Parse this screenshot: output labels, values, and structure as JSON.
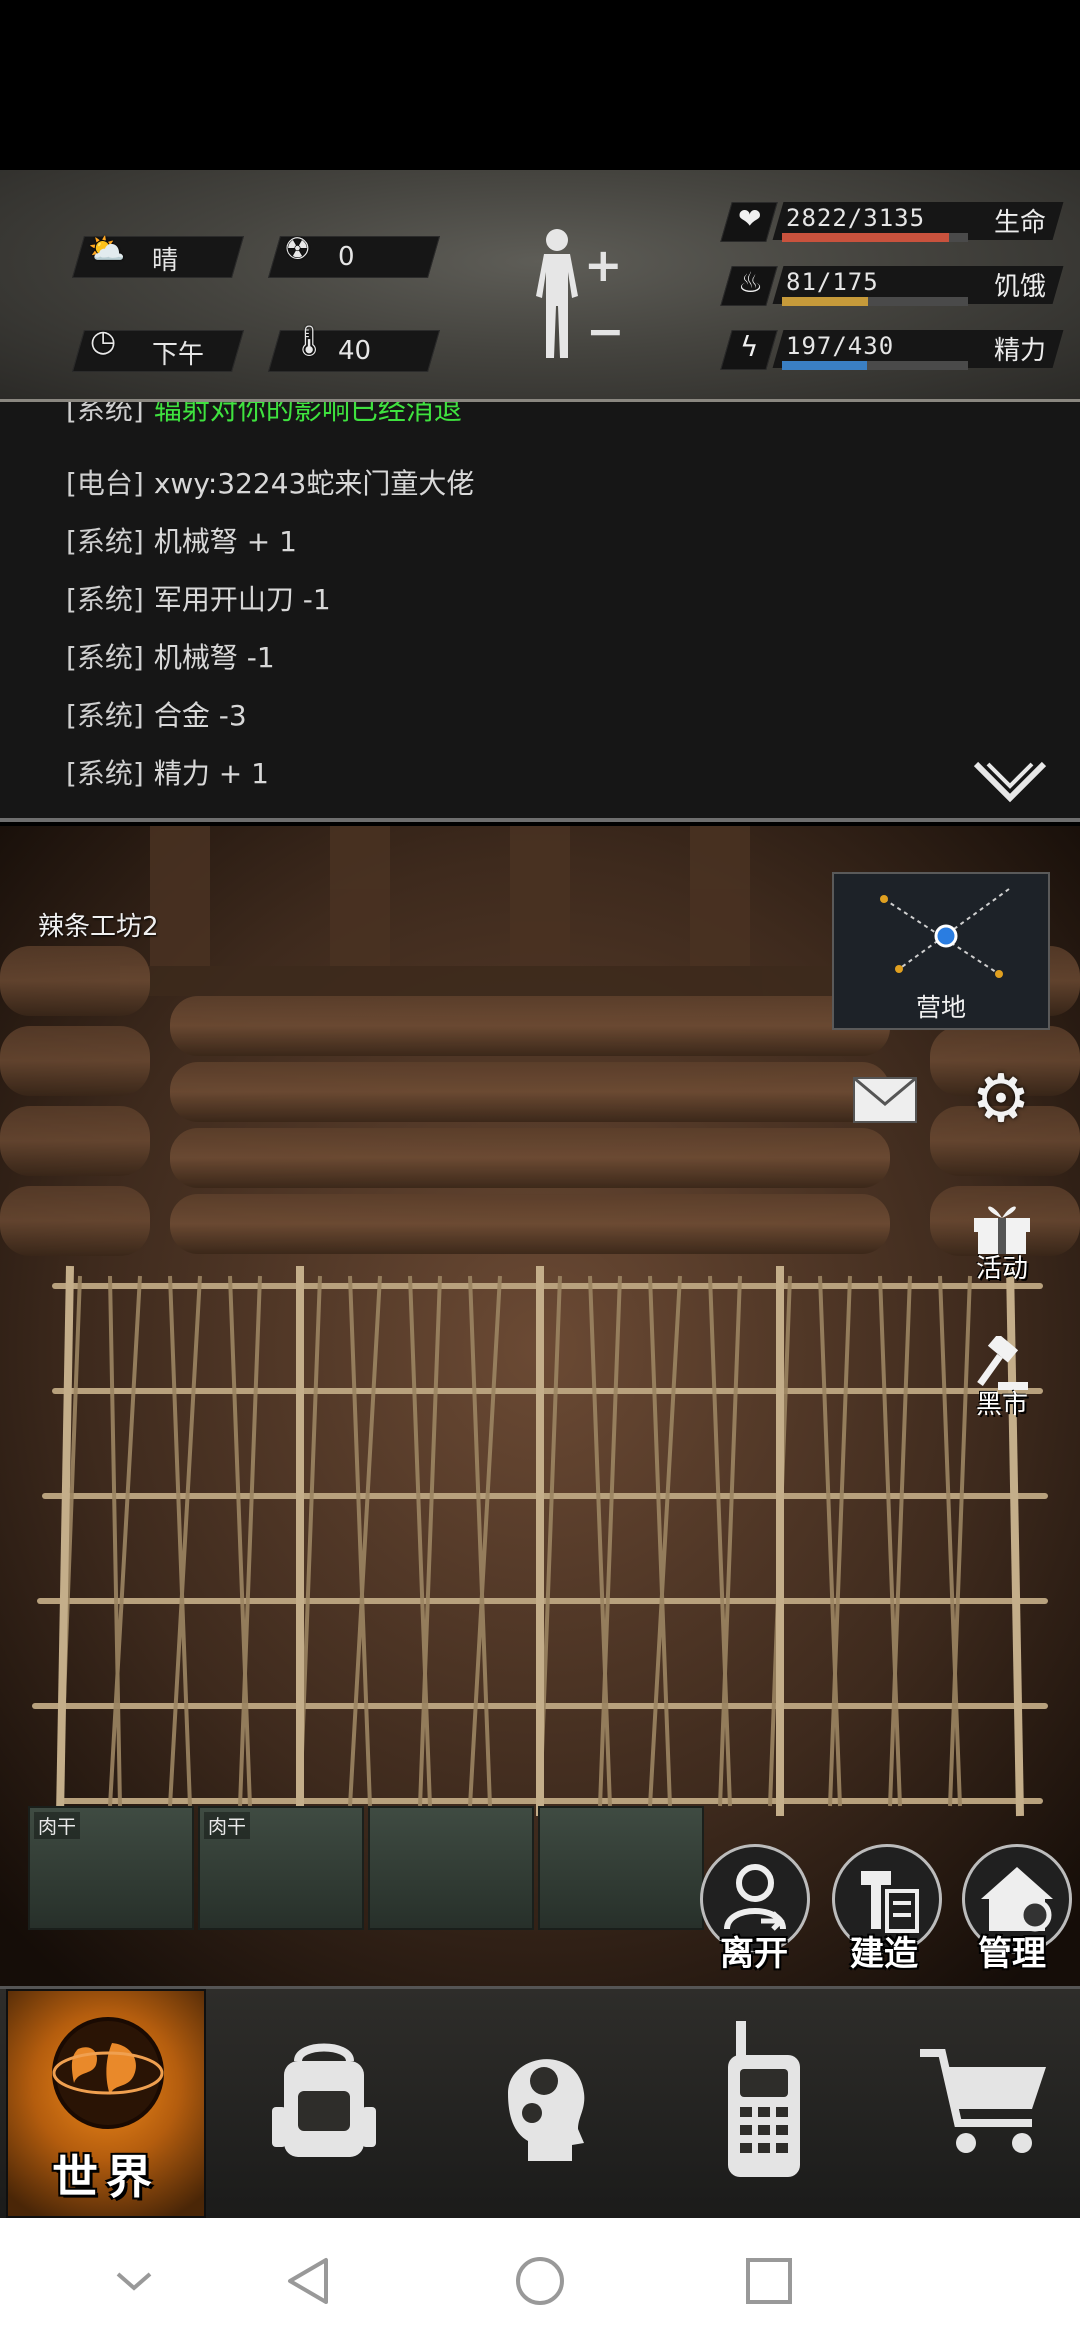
{
  "status": {
    "weather": {
      "icon": "sun-cloud-icon",
      "label": "晴"
    },
    "radiation": {
      "icon": "radiation-icon",
      "value": "0"
    },
    "time": {
      "icon": "clock-icon",
      "label": "下午"
    },
    "temperature": {
      "icon": "thermometer-icon",
      "value": "40"
    }
  },
  "vitals": [
    {
      "key": "health",
      "icon": "heart-icon",
      "text": "2822/3135",
      "label": "生命",
      "current": 2822,
      "max": 3135,
      "color": "#c9523d"
    },
    {
      "key": "hunger",
      "icon": "stomach-icon",
      "text": "81/175",
      "label": "饥饿",
      "current": 81,
      "max": 175,
      "color": "#c69a3a"
    },
    {
      "key": "energy",
      "icon": "energy-icon",
      "text": "197/430",
      "label": "精力",
      "current": 197,
      "max": 430,
      "color": "#3a7fc4"
    }
  ],
  "chat": {
    "partial_line": {
      "tag": "[系统]",
      "text": "辐射对你的影响已经消退"
    },
    "lines": [
      {
        "tag": "[电台]",
        "text": "xwy:32243蛇来门童大佬"
      },
      {
        "tag": "[系统]",
        "text": "机械弩 + 1"
      },
      {
        "tag": "[系统]",
        "text": "军用开山刀 -1"
      },
      {
        "tag": "[系统]",
        "text": "机械弩 -1"
      },
      {
        "tag": "[系统]",
        "text": "合金 -3"
      },
      {
        "tag": "[系统]",
        "text": "精力 + 1"
      }
    ]
  },
  "scene": {
    "room_name": "辣条工坊2",
    "minimap_label": "营地",
    "side_buttons": {
      "activity": "活动",
      "black_market": "黑市"
    },
    "crates": [
      "肉干",
      "肉干",
      "",
      ""
    ],
    "actions": {
      "leave": "离开",
      "build": "建造",
      "manage": "管理"
    }
  },
  "nav": {
    "world": "世界",
    "items": [
      "backpack-icon",
      "skills-head-icon",
      "radio-icon",
      "cart-icon"
    ]
  },
  "colors": {
    "hp": "#c9523d",
    "hunger": "#c69a3a",
    "energy": "#3a7fc4",
    "chat_system_green": "#3fe23f",
    "world_orange": "#f18a1a"
  }
}
